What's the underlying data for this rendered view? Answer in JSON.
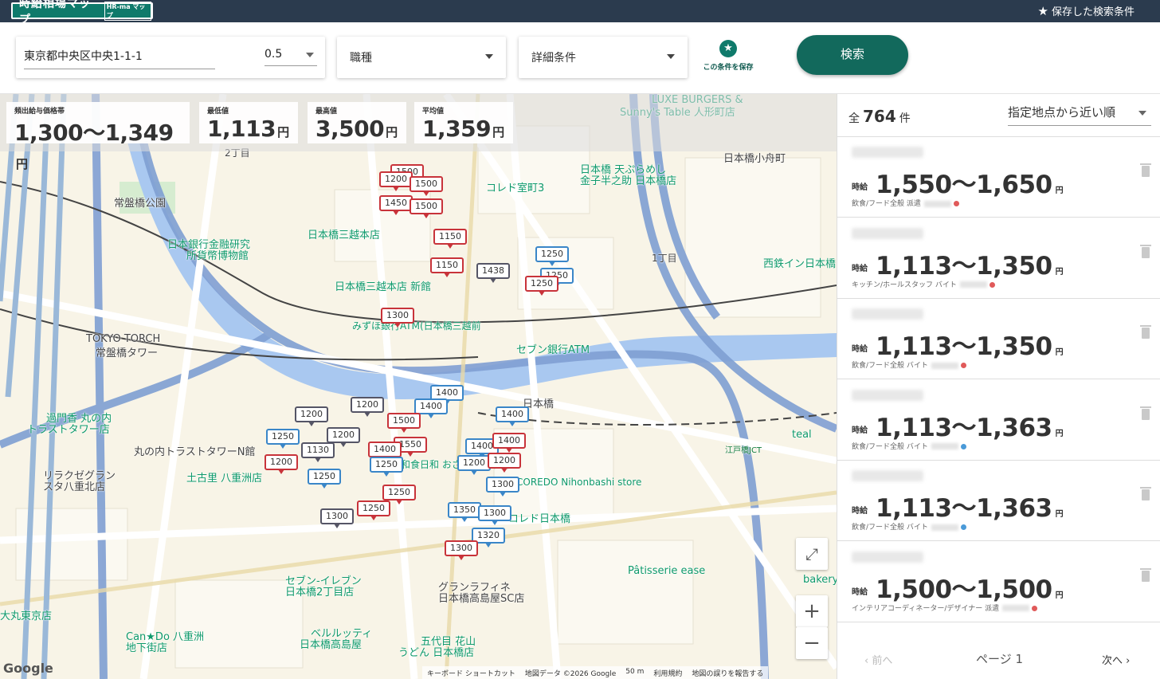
{
  "header": {
    "logo_text": "時給相場マップ",
    "logo_sub": "HR-ma マップ",
    "saved_conditions": "保存した検索条件"
  },
  "search": {
    "address": "東京都中央区中央1-1-1",
    "radius": "0.5",
    "job_type": "職種",
    "detail": "詳細条件",
    "save_condition": "この条件を保存",
    "search_button": "検索"
  },
  "stats": {
    "frequent": {
      "title": "頻出給与価格帯",
      "value": "1,300〜1,349",
      "unit": "円"
    },
    "min": {
      "title": "最低値",
      "value": "1,113",
      "unit": "円"
    },
    "max": {
      "title": "最高値",
      "value": "3,500",
      "unit": "円"
    },
    "avg": {
      "title": "平均値",
      "value": "1,359",
      "unit": "円"
    }
  },
  "map": {
    "labels": [
      {
        "text": "LUXE BURGERS &",
        "color": "#0f9a6b"
      },
      {
        "text": "Sunny's Table 人形町店",
        "color": "#0f9a6b"
      },
      {
        "text": "日本橋小舟町",
        "color": "#444"
      },
      {
        "text": "常盤橋公園",
        "color": "#444"
      },
      {
        "text": "日本銀行金融研究",
        "color": "#0f9a6b"
      },
      {
        "text": "所貨幣博物館",
        "color": "#0f9a6b"
      },
      {
        "text": "日本橋三越本店",
        "color": "#0f9a6b"
      },
      {
        "text": "日本橋三越本店 新館",
        "color": "#0f9a6b"
      },
      {
        "text": "コレド室町3",
        "color": "#0f9a6b"
      },
      {
        "text": "日本橋 天ぷらめし",
        "color": "#0f9a6b"
      },
      {
        "text": "金子半之助 日本橋店",
        "color": "#0f9a6b"
      },
      {
        "text": "TOKYO TORCH",
        "color": "#444"
      },
      {
        "text": "常盤橋タワー",
        "color": "#444"
      },
      {
        "text": "みずほ銀行ATM(日本橋三越前",
        "color": "#0f9a6b"
      },
      {
        "text": "セブン銀行ATM",
        "color": "#0f9a6b"
      },
      {
        "text": "日本橋",
        "color": "#444"
      },
      {
        "text": "過門香 丸の内",
        "color": "#0f9a6b"
      },
      {
        "text": "トラストタワー店",
        "color": "#0f9a6b"
      },
      {
        "text": "丸の内トラストタワーN館",
        "color": "#444"
      },
      {
        "text": "リラクゼグラン",
        "color": "#444"
      },
      {
        "text": "スタ八重北店",
        "color": "#444"
      },
      {
        "text": "土古里 八重洲店",
        "color": "#0f9a6b"
      },
      {
        "text": "和食日和 おさけと日本橋",
        "color": "#0f9a6b"
      },
      {
        "text": "COREDO Nihonbashi store",
        "color": "#0f9a6b"
      },
      {
        "text": "コレド日本橋",
        "color": "#0f9a6b"
      },
      {
        "text": "西鉄イン日本橋",
        "color": "#0f9a6b"
      },
      {
        "text": "teal",
        "color": "#0f9a6b"
      },
      {
        "text": "江戸橋JCT",
        "color": "#0f7a3b"
      },
      {
        "text": "セブン-イレブン",
        "color": "#0f9a6b"
      },
      {
        "text": "日本橋2丁目店",
        "color": "#0f9a6b"
      },
      {
        "text": "グランラフィネ",
        "color": "#444"
      },
      {
        "text": "日本橋高島屋SC店",
        "color": "#444"
      },
      {
        "text": "ベルルッティ",
        "color": "#0f9a6b"
      },
      {
        "text": "日本橋高島屋",
        "color": "#0f9a6b"
      },
      {
        "text": "五代目 花山",
        "color": "#0f9a6b"
      },
      {
        "text": "うどん 日本橋店",
        "color": "#0f9a6b"
      },
      {
        "text": "Pâtisserie ease",
        "color": "#0f9a6b"
      },
      {
        "text": "bakery",
        "color": "#0f9a6b"
      },
      {
        "text": "Can★Do 八重洲",
        "color": "#0f9a6b"
      },
      {
        "text": "地下街店",
        "color": "#0f9a6b"
      },
      {
        "text": "大丸東京店",
        "color": "#0f9a6b"
      },
      {
        "text": "1丁目",
        "color": "#444"
      },
      {
        "text": "2丁目",
        "color": "#444"
      }
    ],
    "pins": [
      {
        "v": "1500",
        "c": "red"
      },
      {
        "v": "1200",
        "c": "red"
      },
      {
        "v": "1500",
        "c": "red"
      },
      {
        "v": "1450",
        "c": "red"
      },
      {
        "v": "1500",
        "c": "red"
      },
      {
        "v": "1150",
        "c": "red"
      },
      {
        "v": "1150",
        "c": "red"
      },
      {
        "v": "1438",
        "c": "gray"
      },
      {
        "v": "1250",
        "c": "blue"
      },
      {
        "v": "1250",
        "c": "blue"
      },
      {
        "v": "1250",
        "c": "red"
      },
      {
        "v": "1300",
        "c": "red"
      },
      {
        "v": "1200",
        "c": "gray"
      },
      {
        "v": "1200",
        "c": "gray"
      },
      {
        "v": "1400",
        "c": "blue"
      },
      {
        "v": "1400",
        "c": "blue"
      },
      {
        "v": "1500",
        "c": "red"
      },
      {
        "v": "1550",
        "c": "red"
      },
      {
        "v": "1400",
        "c": "red"
      },
      {
        "v": "1250",
        "c": "blue"
      },
      {
        "v": "1200",
        "c": "gray"
      },
      {
        "v": "1250",
        "c": "blue"
      },
      {
        "v": "1130",
        "c": "gray"
      },
      {
        "v": "1200",
        "c": "red"
      },
      {
        "v": "1250",
        "c": "blue"
      },
      {
        "v": "1250",
        "c": "red"
      },
      {
        "v": "1250",
        "c": "red"
      },
      {
        "v": "1300",
        "c": "gray"
      },
      {
        "v": "1400",
        "c": "blue"
      },
      {
        "v": "1400",
        "c": "red"
      },
      {
        "v": "1200",
        "c": "blue"
      },
      {
        "v": "1200",
        "c": "red"
      },
      {
        "v": "1300",
        "c": "blue"
      },
      {
        "v": "1350",
        "c": "blue"
      },
      {
        "v": "1300",
        "c": "blue"
      },
      {
        "v": "1320",
        "c": "blue"
      },
      {
        "v": "1300",
        "c": "red"
      },
      {
        "v": "1400",
        "c": "blue"
      }
    ],
    "attribution": [
      "キーボード ショートカット",
      "地図データ ©2026 Google",
      "50 m",
      "利用規約",
      "地図の誤りを報告する"
    ],
    "google": "Google"
  },
  "results": {
    "total_prefix": "全",
    "total": "764",
    "total_suffix": "件",
    "sort": "指定地点から近い順",
    "items": [
      {
        "label": "時給",
        "wage": "1,550〜1,650",
        "unit": "円",
        "category": "飲食/フード全般",
        "type": "派遣",
        "dot": "#e05a5a"
      },
      {
        "label": "時給",
        "wage": "1,113〜1,350",
        "unit": "円",
        "category": "キッチン/ホールスタッフ",
        "type": "バイト",
        "dot": "#e05a5a"
      },
      {
        "label": "時給",
        "wage": "1,113〜1,350",
        "unit": "円",
        "category": "飲食/フード全般",
        "type": "バイト",
        "dot": "#e05a5a"
      },
      {
        "label": "時給",
        "wage": "1,113〜1,363",
        "unit": "円",
        "category": "飲食/フード全般",
        "type": "バイト",
        "dot": "#4a9ad8"
      },
      {
        "label": "時給",
        "wage": "1,113〜1,363",
        "unit": "円",
        "category": "飲食/フード全般",
        "type": "バイト",
        "dot": "#4a9ad8"
      },
      {
        "label": "時給",
        "wage": "1,500〜1,500",
        "unit": "円",
        "category": "インテリアコーディネーター/デザイナー",
        "type": "派遣",
        "dot": "#e05a5a"
      }
    ],
    "pager": {
      "prev": "前へ",
      "page": "ページ 1",
      "next": "次へ"
    }
  }
}
